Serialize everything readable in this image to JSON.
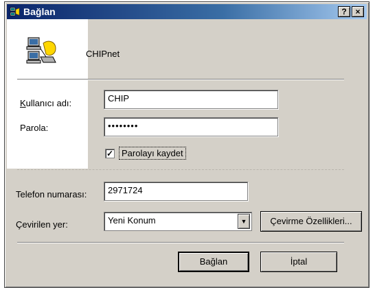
{
  "window": {
    "title": "Bağlan",
    "help_btn": "?",
    "close_btn": "×",
    "connection_name": "CHIPnet",
    "icons": {
      "title": "network-connection-icon",
      "header": "dial-up-computers-icon"
    }
  },
  "form": {
    "username_label": "Kullanıcı adı:",
    "username_value": "CHIP",
    "password_label": "Parola:",
    "password_value": "••••••••",
    "save_password_label": "Parolayı kaydet",
    "save_password_checked": true,
    "phone_label": "Telefon numarası:",
    "phone_value": "2971724",
    "dial_from_label": "Çevirilen yer:",
    "dial_from_value": "Yeni Konum",
    "dial_properties_label": "Çevirme Özellikleri..."
  },
  "buttons": {
    "connect": "Bağlan",
    "cancel": "İptal"
  },
  "colors": {
    "titlebar_start": "#0a246a",
    "titlebar_end": "#a6caf0",
    "face": "#d4d0c8"
  }
}
